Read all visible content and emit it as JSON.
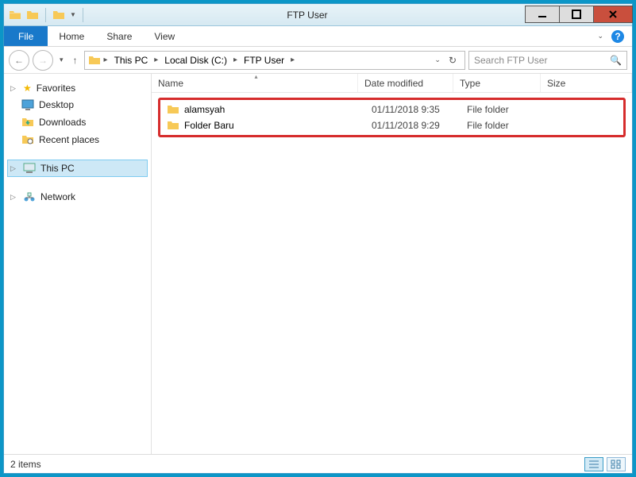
{
  "window": {
    "title": "FTP User"
  },
  "ribbon": {
    "file": "File",
    "tabs": [
      "Home",
      "Share",
      "View"
    ]
  },
  "breadcrumb": [
    "This PC",
    "Local Disk (C:)",
    "FTP User"
  ],
  "search": {
    "placeholder": "Search FTP User"
  },
  "sidebar": {
    "favorites": {
      "label": "Favorites",
      "items": [
        "Desktop",
        "Downloads",
        "Recent places"
      ]
    },
    "thispc": {
      "label": "This PC"
    },
    "network": {
      "label": "Network"
    }
  },
  "columns": {
    "name": "Name",
    "date": "Date modified",
    "type": "Type",
    "size": "Size"
  },
  "items": [
    {
      "name": "alamsyah",
      "date": "01/11/2018 9:35",
      "type": "File folder"
    },
    {
      "name": "Folder Baru",
      "date": "01/11/2018 9:29",
      "type": "File folder"
    }
  ],
  "status": {
    "count": "2 items"
  }
}
